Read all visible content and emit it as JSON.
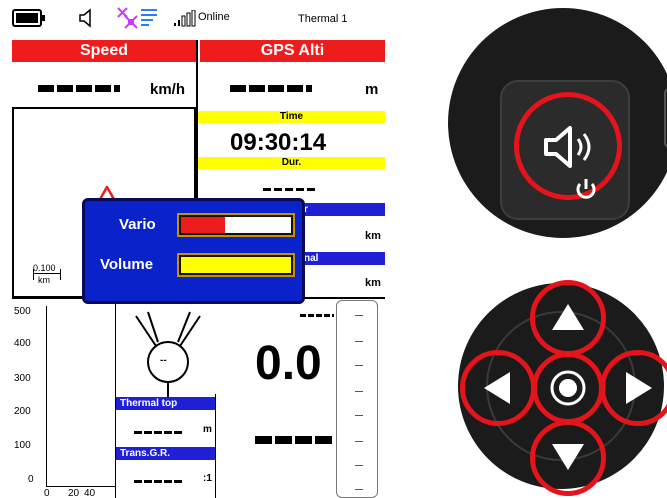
{
  "status_bar": {
    "network_status": "Online",
    "mode_label": "Thermal 1",
    "icons": [
      "battery-icon",
      "speaker-icon",
      "gps-satellite-icon",
      "signal-bars-icon"
    ]
  },
  "speed": {
    "title": "Speed",
    "value": "-----",
    "unit": "km/h"
  },
  "gps_alti": {
    "title": "GPS Alti",
    "value": "-----",
    "unit": "m"
  },
  "time": {
    "title": "Time",
    "value": "09:30:14"
  },
  "duration": {
    "title": "Dur.",
    "value": "-----"
  },
  "blue_fields": [
    {
      "title": "r",
      "unit": "km"
    },
    {
      "title": "nal",
      "unit": "km"
    }
  ],
  "map": {
    "scale_value": "0.100",
    "scale_unit": "km"
  },
  "popup": {
    "vario_label": "Vario",
    "volume_label": "Volume",
    "vario_level": 0.4,
    "volume_level": 1.0
  },
  "altitude_chart": {
    "y_ticks": [
      "500",
      "400",
      "300",
      "200",
      "100",
      "0"
    ],
    "x_ticks": [
      "0",
      "20",
      "40"
    ]
  },
  "wind": {
    "value": "--"
  },
  "thermal_top": {
    "title": "Thermal top",
    "value": "-----",
    "unit": "m"
  },
  "trans_gr": {
    "title": "Trans.G.R.",
    "value": "-----",
    "unit": ":1"
  },
  "vario_display": {
    "value": "0.0",
    "lower_value": "-----",
    "top_value": "---"
  },
  "colors": {
    "header_red": "#ee1c1c",
    "header_yellow": "#ffff00",
    "header_blue": "#1f1fd6",
    "popup_blue": "#0a22c9",
    "ring_red": "#e3141b"
  }
}
